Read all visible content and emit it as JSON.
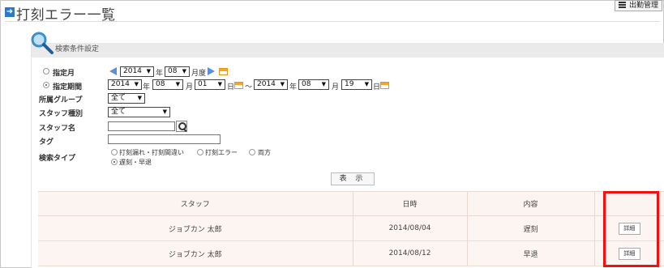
{
  "header": {
    "title": "打刻エラー一覧",
    "attendance_button": "出勤管理"
  },
  "search": {
    "panel_title": "検索条件設定",
    "month_mode": {
      "label": "指定月",
      "selected": false,
      "year": "2014",
      "year_unit": "年",
      "month": "08",
      "month_unit": "月度"
    },
    "period_mode": {
      "label": "指定期間",
      "selected": true,
      "from_year": "2014",
      "from_month": "08",
      "from_day": "01",
      "to_year": "2014",
      "to_month": "08",
      "to_day": "19",
      "year_unit": "年",
      "month_unit": "月",
      "day_unit": "日",
      "separator": "～"
    },
    "group": {
      "label": "所属グループ",
      "value": "全て"
    },
    "staff_type": {
      "label": "スタッフ種別",
      "value": "全て"
    },
    "staff_name": {
      "label": "スタッフ名",
      "value": ""
    },
    "tag": {
      "label": "タグ",
      "value": ""
    },
    "search_type": {
      "label": "検索タイプ",
      "options": [
        {
          "label": "打刻漏れ・打刻間違い",
          "selected": false
        },
        {
          "label": "打刻エラー",
          "selected": false
        },
        {
          "label": "両方",
          "selected": false
        },
        {
          "label": "遅刻・早退",
          "selected": true
        }
      ]
    },
    "show_button": "表 示"
  },
  "table": {
    "headers": [
      "スタッフ",
      "日時",
      "内容",
      ""
    ],
    "rows": [
      {
        "staff": "ジョブカン 太郎",
        "date": "2014/08/04",
        "content": "遅刻",
        "action": "詳細"
      },
      {
        "staff": "ジョブカン 太郎",
        "date": "2014/08/12",
        "content": "早退",
        "action": "詳細"
      }
    ]
  },
  "colors": {
    "accent": "#2a7ac8",
    "highlight": "#ee1111",
    "table_bg": "#fcf5f1"
  }
}
